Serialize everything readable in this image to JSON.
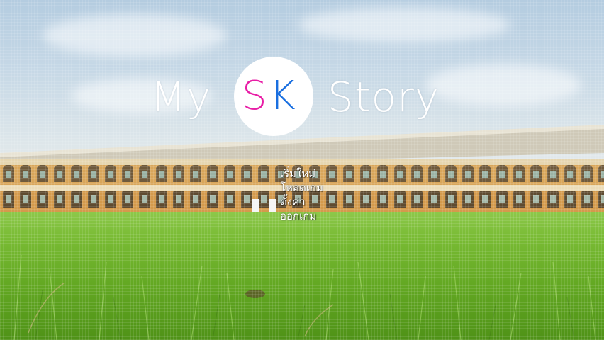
{
  "title": {
    "left_word": "My",
    "logo_letter_1": "S",
    "logo_letter_2": "K",
    "right_word": "Story"
  },
  "colors": {
    "logo_s": "#e81ea6",
    "logo_k": "#1a6fe0",
    "title_text": "#ffffff",
    "logo_circle": "#ffffff"
  },
  "menu": {
    "items": [
      {
        "label": "เริ่มใหม่"
      },
      {
        "label": "โหลดเกม"
      },
      {
        "label": "ตั้งค่า"
      },
      {
        "label": "ออกเกม"
      }
    ]
  }
}
